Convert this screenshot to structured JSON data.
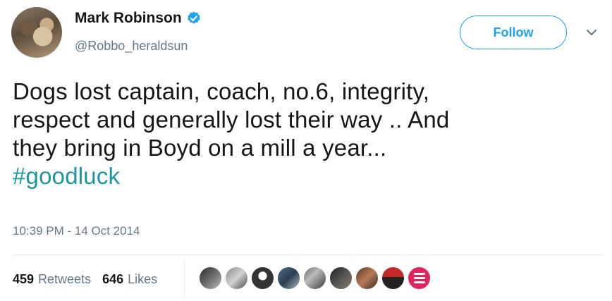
{
  "tweet": {
    "author": {
      "name": "Mark Robinson",
      "handle": "@Robbo_heraldsun",
      "verified": true
    },
    "follow_label": "Follow",
    "text_lines": [
      "Dogs lost captain, coach, no.6, integrity,",
      "respect and generally lost their way .. And",
      "they bring in Boyd on a mill a year..."
    ],
    "hashtag": "#goodluck",
    "timestamp": "10:39 PM - 14 Oct 2014",
    "stats": {
      "retweets_count": "459",
      "retweets_label": "Retweets",
      "likes_count": "646",
      "likes_label": "Likes"
    }
  },
  "colors": {
    "accent": "#1da1f2",
    "hashtag": "#1b95a0",
    "secondary_text": "#657786",
    "primary_text": "#14171a"
  },
  "icons": [
    "verified-badge-icon",
    "chevron-down-icon"
  ]
}
